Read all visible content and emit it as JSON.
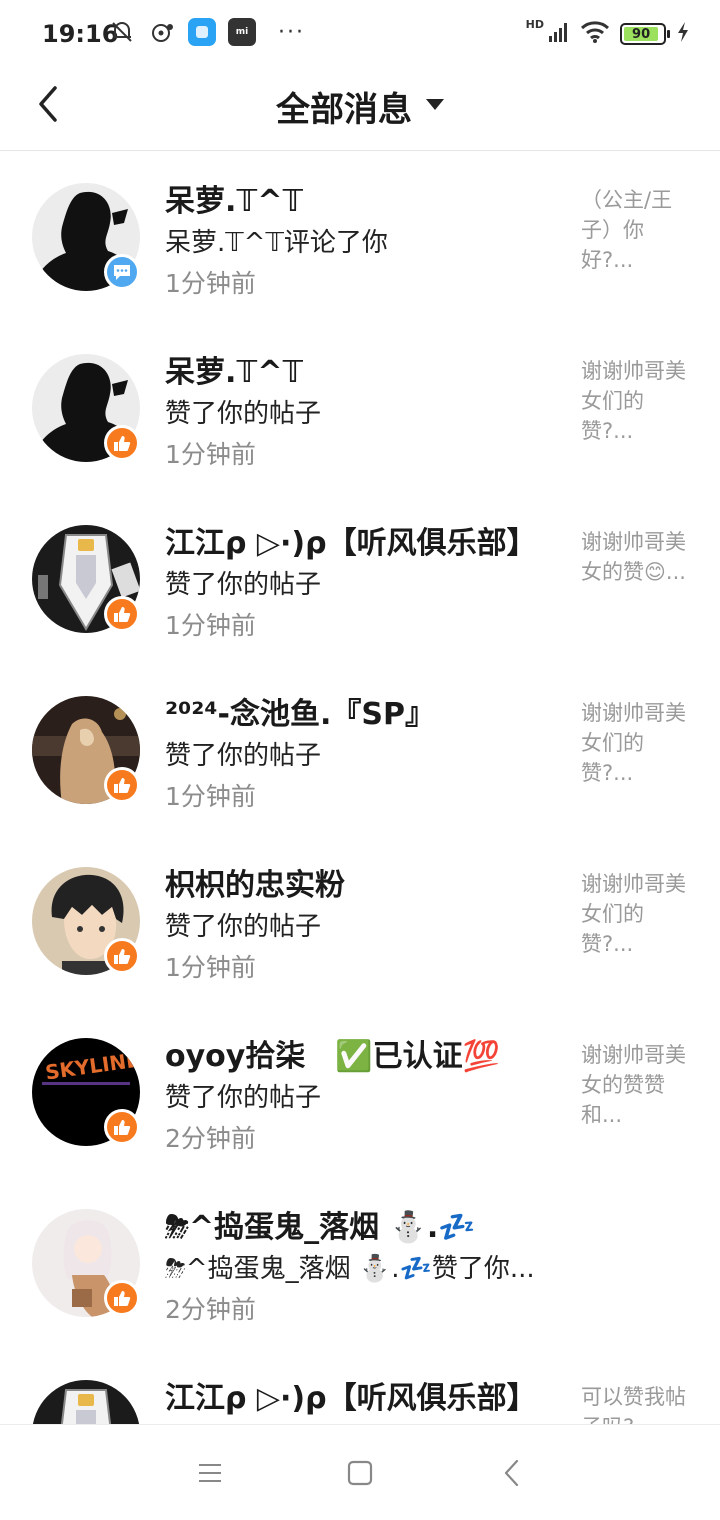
{
  "status_bar": {
    "time": "19:16",
    "signal_label": "HD",
    "battery": "90",
    "more_dots": "···"
  },
  "header": {
    "title": "全部消息"
  },
  "messages": [
    {
      "name": "呆萝.𝕋^𝕋",
      "action": "呆萝.𝕋^𝕋评论了你",
      "time": "1分钟前",
      "preview": "（公主/王子）你好?...",
      "badge": "comment"
    },
    {
      "name": "呆萝.𝕋^𝕋",
      "action": "赞了你的帖子",
      "time": "1分钟前",
      "preview": "谢谢帅哥美女们的赞?...",
      "badge": "like"
    },
    {
      "name": "江江ρ ▷·)ρ【听风俱乐部】",
      "action": "赞了你的帖子",
      "time": "1分钟前",
      "preview": "谢谢帅哥美女的赞😊...",
      "badge": "like"
    },
    {
      "name": "²⁰²⁴-念池鱼.『SP』",
      "action": "赞了你的帖子",
      "time": "1分钟前",
      "preview": "谢谢帅哥美女们的赞?...",
      "badge": "like"
    },
    {
      "name": "枳枳的忠实粉",
      "action": "赞了你的帖子",
      "time": "1分钟前",
      "preview": "谢谢帅哥美女们的赞?...",
      "badge": "like"
    },
    {
      "name": "oyoy拾柒　✅已认证💯",
      "action": "赞了你的帖子",
      "time": "2分钟前",
      "preview": "谢谢帅哥美女的赞赞和...",
      "badge": "like"
    },
    {
      "name": "⛈^捣蛋鬼_落烟 ⛄.💤",
      "action": "⛈^捣蛋鬼_落烟 ⛄.💤赞了你...",
      "time": "2分钟前",
      "preview": "",
      "badge": "like"
    },
    {
      "name": "江江ρ ▷·)ρ【听风俱乐部】",
      "action": "",
      "time": "",
      "preview": "可以赞我帖子吗?",
      "badge": "like"
    }
  ],
  "colors": {
    "like_badge": "#f77a1e",
    "comment_badge": "#4fa8f0",
    "time_text": "#8c8c8c",
    "preview_text": "#9a9a9a"
  }
}
